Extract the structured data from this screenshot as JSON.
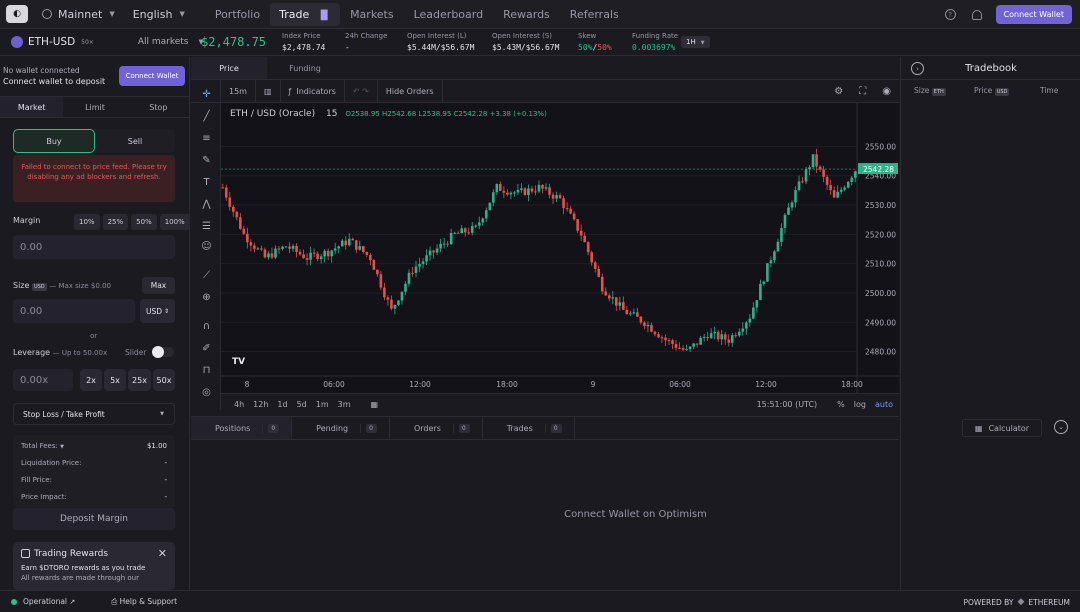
{
  "topbar": {
    "network": "Mainnet",
    "language": "English",
    "nav": [
      "Portfolio",
      "Trade",
      "Markets",
      "Leaderboard",
      "Rewards",
      "Referrals"
    ],
    "active_nav": "Trade",
    "connect": "Connect Wallet"
  },
  "market": {
    "name": "ETH-USD",
    "leverage": "50×",
    "all_markets": "All markets",
    "price": "$2,478.75",
    "stats": [
      {
        "label": "Index Price",
        "value": "$2,478.74"
      },
      {
        "label": "24h Change",
        "value": "-"
      },
      {
        "label": "Open Interest (L)",
        "value": "$5.44M/$56.67M"
      },
      {
        "label": "Open Interest (S)",
        "value": "$5.43M/$56.67M"
      }
    ],
    "skew_label": "Skew",
    "skew_long": "50%",
    "skew_sep": "/",
    "skew_short": "50%",
    "funding_label": "Funding Rate",
    "funding_value": "0.003697%",
    "funding_period": "1H"
  },
  "left": {
    "no_wallet": "No wallet connected",
    "connect_to_deposit": "Connect wallet to deposit",
    "connect_btn": "Connect Wallet",
    "tabs": [
      "Market",
      "Limit",
      "Stop"
    ],
    "buy": "Buy",
    "sell": "Sell",
    "error": "Failed to connect to price feed. Please try disabling any ad blockers and refresh.",
    "margin_label": "Margin",
    "margin_pcts": [
      "10%",
      "25%",
      "50%",
      "100%"
    ],
    "margin_value": "0.00",
    "size_label": "Size",
    "size_unit_tag": "USD",
    "max_size": "Max size $0.00",
    "max_btn": "Max",
    "size_value": "0.00",
    "size_unit": "USD",
    "or": "or",
    "leverage_label": "Leverage",
    "leverage_range": "Up to 50.00x",
    "slider_label": "Slider",
    "leverage_value": "0.00x",
    "leverage_btns": [
      "2x",
      "5x",
      "25x",
      "50x"
    ],
    "sltp": "Stop Loss / Take Profit",
    "fees": [
      {
        "label": "Total Fees:",
        "value": "$1.00"
      },
      {
        "label": "Liquidation Price:",
        "value": "-"
      },
      {
        "label": "Fill Price:",
        "value": "-"
      },
      {
        "label": "Price Impact:",
        "value": "-"
      }
    ],
    "deposit": "Deposit Margin",
    "rewards_title": "Trading Rewards",
    "rewards_line1": "Earn $DTORO rewards as you trade",
    "rewards_line2": "All rewards are made through our"
  },
  "chart": {
    "tabs": [
      "Price",
      "Funding"
    ],
    "interval": "15m",
    "indicators": "Indicators",
    "hide_orders": "Hide Orders",
    "symbol": "ETH / USD (Oracle)",
    "res": "15",
    "ohlc": "O2538.95 H2542.68 L2538.95 C2542.28 +3.38 (+0.13%)",
    "current_tag": "2542.28",
    "ranges": [
      "4h",
      "12h",
      "1d",
      "5d",
      "1m",
      "3m"
    ],
    "time": "15:51:00 (UTC)",
    "scale_opts": [
      "%",
      "log",
      "auto"
    ],
    "time_ticks": [
      {
        "label": "8"
      },
      {
        "label": "06:00"
      },
      {
        "label": "12:00"
      },
      {
        "label": "18:00"
      },
      {
        "label": "9"
      },
      {
        "label": "06:00"
      },
      {
        "label": "12:00"
      },
      {
        "label": "18:00"
      }
    ]
  },
  "chart_data": {
    "type": "candlestick",
    "title": "ETH / USD (Oracle)",
    "ylim": [
      2472,
      2558
    ],
    "yticks": [
      2480,
      2490,
      2500,
      2510,
      2520,
      2530,
      2540,
      2550
    ],
    "last": 2542.28,
    "anchors": [
      [
        0,
        2536
      ],
      [
        6,
        2520
      ],
      [
        12,
        2512
      ],
      [
        18,
        2516
      ],
      [
        24,
        2512
      ],
      [
        30,
        2514
      ],
      [
        36,
        2518
      ],
      [
        42,
        2512
      ],
      [
        48,
        2494
      ],
      [
        54,
        2508
      ],
      [
        60,
        2514
      ],
      [
        66,
        2520
      ],
      [
        72,
        2522
      ],
      [
        78,
        2536
      ],
      [
        84,
        2534
      ],
      [
        90,
        2536
      ],
      [
        96,
        2532
      ],
      [
        102,
        2520
      ],
      [
        108,
        2502
      ],
      [
        114,
        2494
      ],
      [
        120,
        2490
      ],
      [
        126,
        2484
      ],
      [
        132,
        2480
      ],
      [
        138,
        2486
      ],
      [
        144,
        2484
      ],
      [
        150,
        2492
      ],
      [
        156,
        2512
      ],
      [
        162,
        2532
      ],
      [
        168,
        2546
      ],
      [
        174,
        2532
      ],
      [
        180,
        2542
      ]
    ]
  },
  "tradebook": {
    "title": "Tradebook",
    "cols": [
      "Size",
      "Price",
      "Time"
    ],
    "tags": [
      "ETH",
      "USD"
    ]
  },
  "positions": {
    "tabs": [
      "Positions",
      "Pending",
      "Orders",
      "Trades"
    ],
    "counts": [
      "0",
      "0",
      "0",
      "0"
    ],
    "calculator": "Calculator",
    "empty": "Connect Wallet on Optimism"
  },
  "footer": {
    "status": "Operational",
    "help": "Help & Support",
    "powered": "POWERED BY",
    "chain": "ETHEREUM"
  }
}
